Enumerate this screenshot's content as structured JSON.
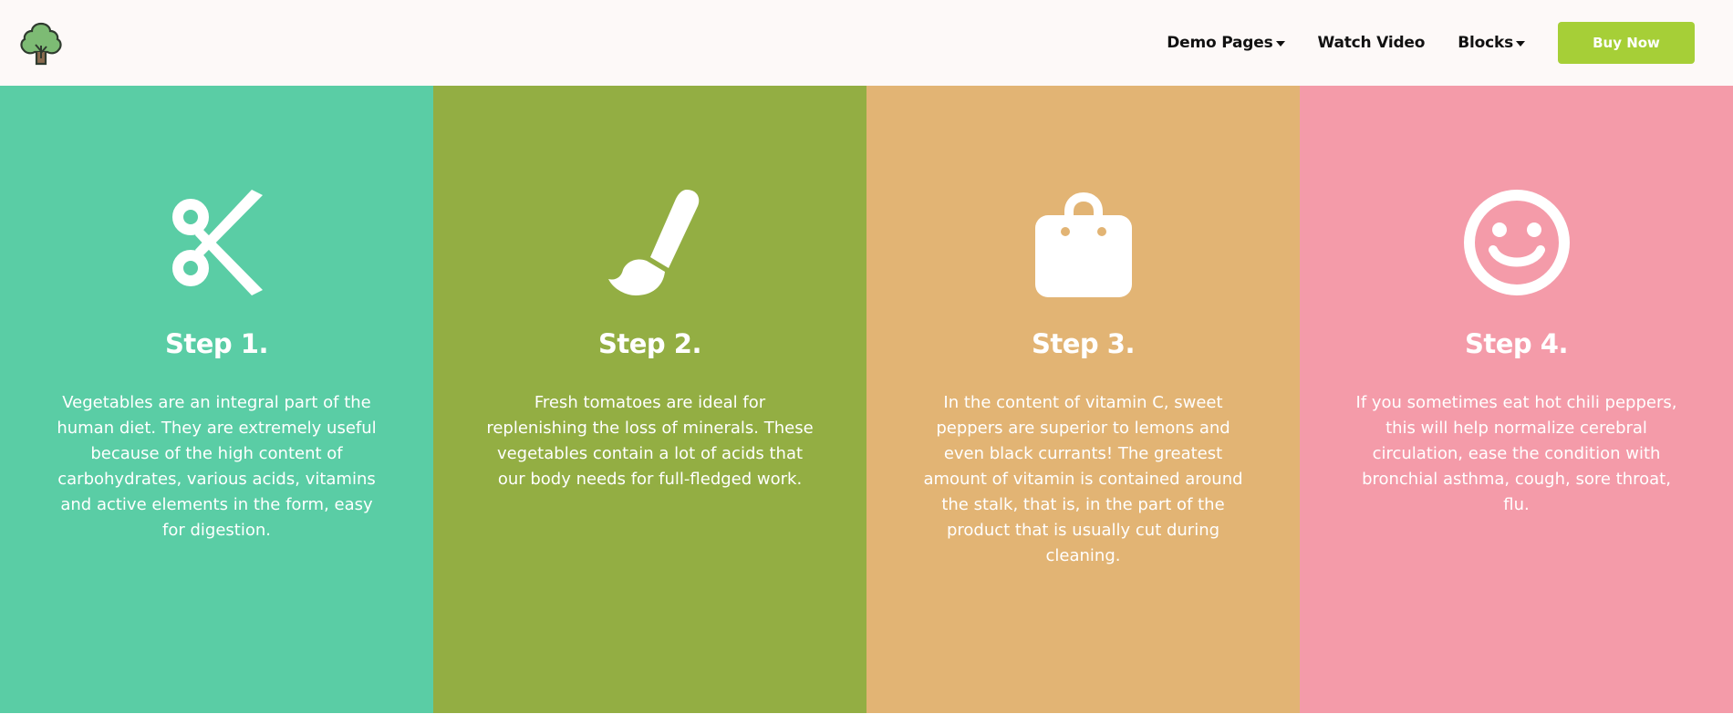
{
  "nav": {
    "links": [
      {
        "label": "Demo Pages",
        "dropdown": true
      },
      {
        "label": "Watch Video",
        "dropdown": false
      },
      {
        "label": "Blocks",
        "dropdown": true
      }
    ],
    "buy_label": "Buy Now",
    "buy_color": "#a6cf37",
    "logo_icon": "broccoli-tree-icon"
  },
  "steps": [
    {
      "title": "Step 1.",
      "icon": "scissors-icon",
      "color": "#5acda5",
      "text": "Vegetables are an integral part of the human diet. They are extremely useful because of the high content of carbohydrates, various acids, vitamins and active elements in the form, easy for digestion."
    },
    {
      "title": "Step 2.",
      "icon": "paintbrush-icon",
      "color": "#93ae43",
      "text": "Fresh tomatoes are ideal for replenishing the loss of minerals. These vegetables contain a lot of acids that our body needs for full-fledged work."
    },
    {
      "title": "Step 3.",
      "icon": "shopping-bag-icon",
      "color": "#e2b474",
      "text": "In the content of vitamin C, sweet peppers are superior to lemons and even black currants! The greatest amount of vitamin is contained around the stalk, that is, in the part of the product that is usually cut during cleaning."
    },
    {
      "title": "Step 4.",
      "icon": "smiley-icon",
      "color": "#f49ba9",
      "text": "If you sometimes eat hot chili peppers, this will help normalize cerebral circulation, ease the condition with bronchial asthma, cough, sore throat, flu."
    }
  ]
}
